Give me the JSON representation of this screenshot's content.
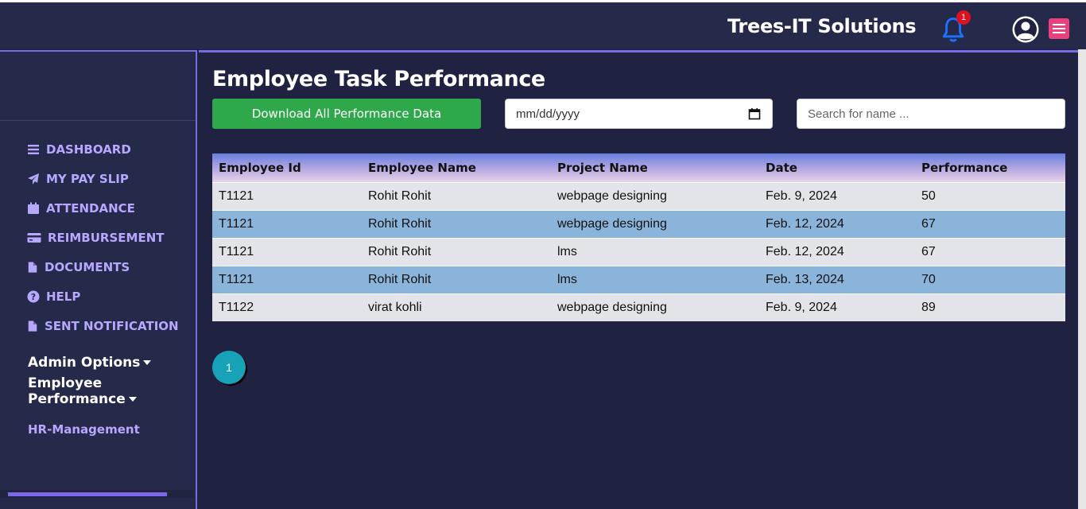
{
  "header": {
    "brand": "Trees-IT Solutions",
    "notification_count": "1"
  },
  "sidebar": {
    "items": [
      {
        "label": "DASHBOARD",
        "icon": "bars-icon"
      },
      {
        "label": "MY PAY SLIP",
        "icon": "paper-plane-icon"
      },
      {
        "label": "ATTENDANCE",
        "icon": "calendar-icon"
      },
      {
        "label": "REIMBURSEMENT",
        "icon": "credit-card-icon"
      },
      {
        "label": "DOCUMENTS",
        "icon": "file-icon"
      },
      {
        "label": "HELP",
        "icon": "question-circle-icon"
      },
      {
        "label": "SENT NOTIFICATION",
        "icon": "file-icon"
      }
    ],
    "admin_options": "Admin Options",
    "employee_performance": "Employee Performance",
    "hr_management": "HR-Management"
  },
  "main": {
    "title": "Employee Task Performance",
    "download_label": "Download All Performance Data",
    "date_placeholder": "mm/dd/yyyy",
    "search_placeholder": "Search for name ...",
    "table": {
      "headers": [
        "Employee Id",
        "Employee Name",
        "Project Name",
        "Date",
        "Performance"
      ],
      "rows": [
        [
          "T1121",
          "Rohit Rohit",
          "webpage designing",
          "Feb. 9, 2024",
          "50"
        ],
        [
          "T1121",
          "Rohit Rohit",
          "webpage designing",
          "Feb. 12, 2024",
          "67"
        ],
        [
          "T1121",
          "Rohit Rohit",
          "lms",
          "Feb. 12, 2024",
          "67"
        ],
        [
          "T1121",
          "Rohit Rohit",
          "lms",
          "Feb. 13, 2024",
          "70"
        ],
        [
          "T1122",
          "virat kohli",
          "webpage designing",
          "Feb. 9, 2024",
          "89"
        ]
      ]
    },
    "pagination": {
      "current_page": "1"
    }
  },
  "colors": {
    "accent": "#7b6ae8",
    "download_button": "#2ea84a",
    "pagination": "#17a2b8",
    "row_alt": "#8ab4da",
    "nav_text": "#b6a8ff",
    "notification_badge": "#e01020",
    "menu_button": "#e8417e"
  }
}
